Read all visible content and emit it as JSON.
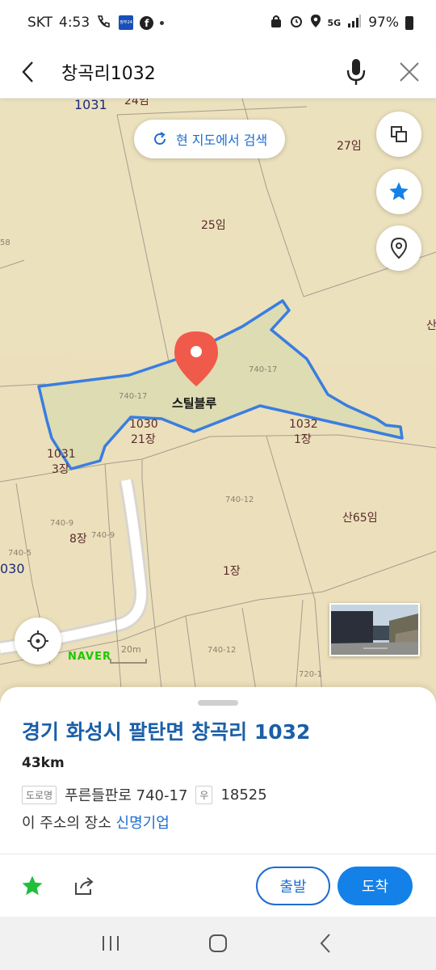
{
  "status_bar": {
    "carrier": "SKT",
    "time": "4:53",
    "badge_text": "정부24",
    "facebook_letter": "f",
    "network": "5G",
    "battery": "97%"
  },
  "header": {
    "query": "창곡리1032"
  },
  "map": {
    "search_here_label": "현 지도에서 검색",
    "place_name": "스틸블루",
    "labels": {
      "lot_1031_top": "1031",
      "lot_24": "24임",
      "lot_27": "27임",
      "lot_25": "25임",
      "lot_58": "58",
      "lot_san": "산",
      "lot_740_17_a": "740-17",
      "lot_740_17_b": "740-17",
      "lot_1030": "1030",
      "lot_21": "21장",
      "lot_1032": "1032",
      "lot_1032_jang": "1장",
      "lot_1031": "1031",
      "lot_3": "3장",
      "lot_740_12_a": "740-12",
      "lot_san65": "산65임",
      "lot_740_9_a": "740-9",
      "lot_8": "8장",
      "lot_740_9_b": "740-9",
      "lot_740_5": "740-5",
      "lot_030": "030",
      "lot_1jang": "1장",
      "lot_740_12_b": "740-12",
      "lot_720_1": "720-1"
    },
    "brand": "NAVER",
    "scale_label": "20m",
    "accent_color": "#3a7de0",
    "pin_color": "#f05a4a"
  },
  "sheet": {
    "address": "경기 화성시 팔탄면 창곡리 1032",
    "distance": "43km",
    "road_tag": "도로명",
    "road_address": "푸른들판로 740-17",
    "zip_tag": "우",
    "zip": "18525",
    "place_prefix": "이 주소의 장소",
    "place_link": "신명기업",
    "start_label": "출발",
    "arrive_label": "도착"
  }
}
